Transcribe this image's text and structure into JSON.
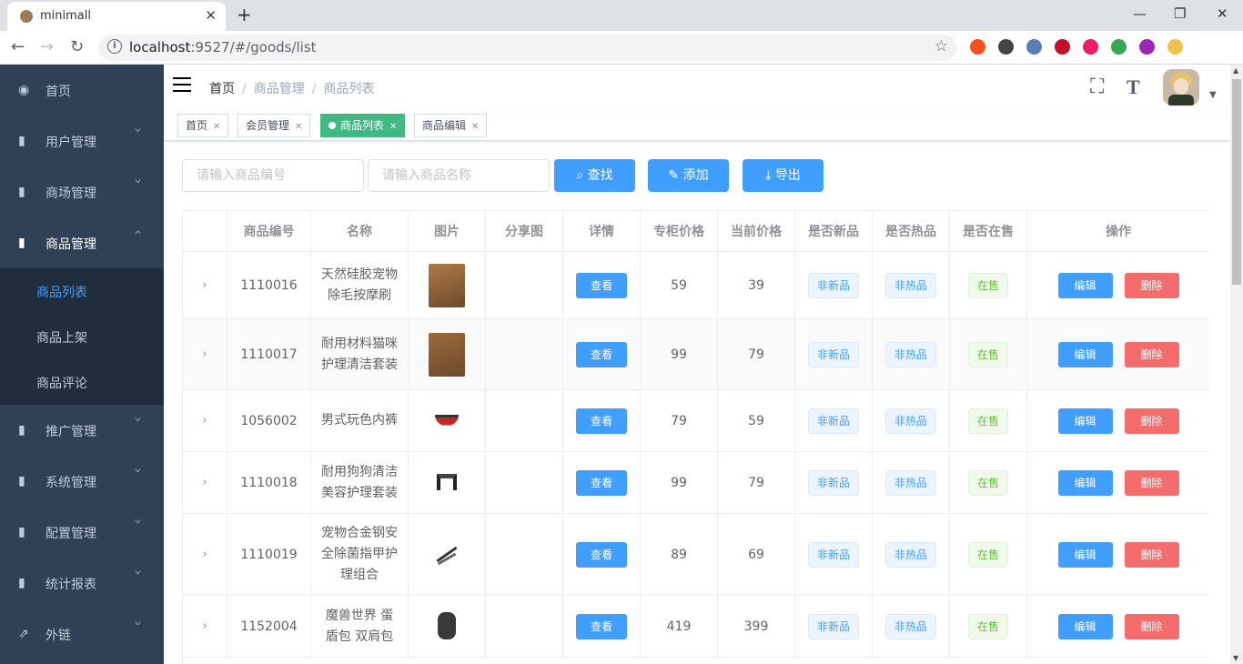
{
  "browser": {
    "tab_title": "minimall",
    "url_host": "localhost",
    "url_rest": ":9527/#/goods/list",
    "extensions": [
      {
        "name": "ext-1",
        "color": "#f4511e"
      },
      {
        "name": "ext-2",
        "color": "#444444"
      },
      {
        "name": "ext-3",
        "color": "#5b7fb5"
      },
      {
        "name": "ext-abp",
        "color": "#c70d2c"
      },
      {
        "name": "ext-5",
        "color": "#e91e63"
      },
      {
        "name": "ext-6",
        "color": "#34a853"
      },
      {
        "name": "ext-rp",
        "color": "#9c27b0"
      },
      {
        "name": "ext-8",
        "color": "#f0c24a"
      }
    ]
  },
  "sidebar": {
    "items": [
      {
        "label": "首页",
        "icon": "dashboard-icon"
      },
      {
        "label": "用户管理",
        "icon": "chart-icon"
      },
      {
        "label": "商场管理",
        "icon": "chart-icon"
      },
      {
        "label": "商品管理",
        "icon": "chart-icon"
      },
      {
        "label": "推广管理",
        "icon": "chart-icon"
      },
      {
        "label": "系统管理",
        "icon": "chart-icon"
      },
      {
        "label": "配置管理",
        "icon": "chart-icon"
      },
      {
        "label": "统计报表",
        "icon": "chart-icon"
      },
      {
        "label": "外链",
        "icon": "external-link-icon"
      }
    ],
    "sub_items": [
      {
        "label": "商品列表"
      },
      {
        "label": "商品上架"
      },
      {
        "label": "商品评论"
      }
    ]
  },
  "breadcrumb": {
    "home": "首页",
    "level1": "商品管理",
    "level2": "商品列表",
    "separator": "/"
  },
  "tags": [
    {
      "label": "首页"
    },
    {
      "label": "会员管理"
    },
    {
      "label": "商品列表"
    },
    {
      "label": "商品编辑"
    }
  ],
  "filter": {
    "goods_sn_placeholder": "请输入商品编号",
    "name_placeholder": "请输入商品名称",
    "search_label": "查找",
    "add_label": "添加",
    "export_label": "导出"
  },
  "table": {
    "headers": [
      "",
      "商品编号",
      "名称",
      "图片",
      "分享图",
      "详情",
      "专柜价格",
      "当前价格",
      "是否新品",
      "是否热品",
      "是否在售",
      "操作"
    ],
    "view_label": "查看",
    "edit_label": "编辑",
    "delete_label": "删除",
    "rows": [
      {
        "sn": "1110016",
        "name": "天然硅胶宠物除毛按摩刷",
        "counter_price": "59",
        "retail_price": "39",
        "is_new": "非新品",
        "is_hot": "非热品",
        "on_sale": "在售"
      },
      {
        "sn": "1110017",
        "name": "耐用材料猫咪护理清洁套装",
        "counter_price": "99",
        "retail_price": "79",
        "is_new": "非新品",
        "is_hot": "非热品",
        "on_sale": "在售"
      },
      {
        "sn": "1056002",
        "name": "男式玩色内裤",
        "counter_price": "79",
        "retail_price": "59",
        "is_new": "非新品",
        "is_hot": "非热品",
        "on_sale": "在售"
      },
      {
        "sn": "1110018",
        "name": "耐用狗狗清洁美容护理套装",
        "counter_price": "99",
        "retail_price": "79",
        "is_new": "非新品",
        "is_hot": "非热品",
        "on_sale": "在售"
      },
      {
        "sn": "1110019",
        "name": "宠物合金钢安全除菌指甲护理组合",
        "counter_price": "89",
        "retail_price": "69",
        "is_new": "非新品",
        "is_hot": "非热品",
        "on_sale": "在售"
      },
      {
        "sn": "1152004",
        "name": "魔兽世界 蛋盾包 双肩包",
        "counter_price": "419",
        "retail_price": "399",
        "is_new": "非新品",
        "is_hot": "非热品",
        "on_sale": "在售"
      }
    ]
  }
}
